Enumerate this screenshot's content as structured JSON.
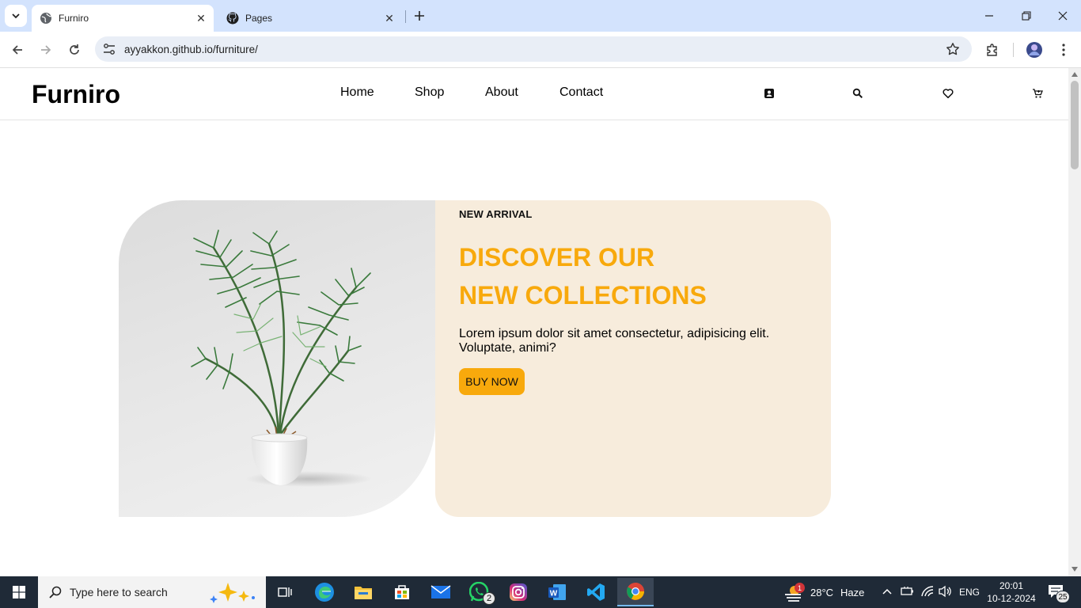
{
  "browser": {
    "tabs": [
      {
        "title": "Furniro",
        "active": true
      },
      {
        "title": "Pages",
        "active": false
      }
    ],
    "address": "ayyakkon.github.io/furniture/"
  },
  "site": {
    "logo": "Furniro",
    "nav": [
      "Home",
      "Shop",
      "About",
      "Contact"
    ],
    "icons": [
      "account-icon",
      "search-icon",
      "heart-icon",
      "cart-icon"
    ]
  },
  "hero": {
    "tagline": "NEW ARRIVAL",
    "headline_line1": "DISCOVER OUR",
    "headline_line2": "NEW COLLECTIONS",
    "description": "Lorem ipsum dolor sit amet consectetur, adipisicing elit. Voluptate, animi?",
    "button": "BUY NOW",
    "accent_color": "#f8a90c",
    "card_color": "#f7ecdc"
  },
  "taskbar": {
    "search_placeholder": "Type here to search",
    "whatsapp_badge": "2",
    "weather_badge": "1",
    "weather": "28°C",
    "weather_desc": "Haze",
    "language": "ENG",
    "time": "20:01",
    "date": "10-12-2024",
    "notifications": "25"
  }
}
